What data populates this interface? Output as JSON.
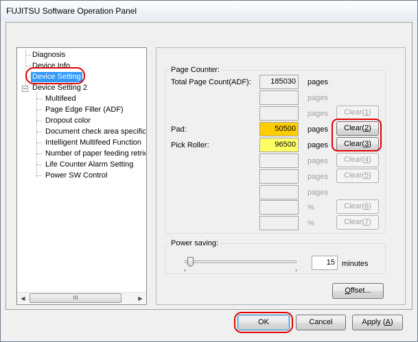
{
  "window": {
    "title": "FUJITSU Software Operation Panel"
  },
  "tree": {
    "items": [
      {
        "label": "Diagnosis"
      },
      {
        "label": "Device Info"
      },
      {
        "label": "Device Setting"
      },
      {
        "label": "Device Setting 2",
        "expander": "−"
      },
      {
        "label": "Multifeed"
      },
      {
        "label": "Page Edge Filler (ADF)"
      },
      {
        "label": "Dropout color"
      },
      {
        "label": "Document check area specific"
      },
      {
        "label": "Intelligent Multifeed Function"
      },
      {
        "label": "Number of paper feeding retrie"
      },
      {
        "label": "Life Counter Alarm Setting"
      },
      {
        "label": "Power SW Control"
      }
    ],
    "scroll_grip": "III",
    "scroll_left": "◀",
    "scroll_right": "▶"
  },
  "page_counter": {
    "group_title": "Page Counter:",
    "total_label": "Total Page Count(ADF):",
    "total_value": "185030",
    "pad_label": "Pad:",
    "pad_value": "50500",
    "pick_label": "Pick Roller:",
    "pick_value": "96500",
    "unit_pages": "pages",
    "unit_percent": "%",
    "clear1": {
      "pre": "Clear(",
      "key": "1",
      "post": ")"
    },
    "clear2": {
      "pre": "Clear(",
      "key": "2",
      "post": ")"
    },
    "clear3": {
      "pre": "Clear(",
      "key": "3",
      "post": ")"
    },
    "clear4": {
      "pre": "Clear(",
      "key": "4",
      "post": ")"
    },
    "clear5": {
      "pre": "Clear(",
      "key": "5",
      "post": ")"
    },
    "clear6": {
      "pre": "Clear(",
      "key": "6",
      "post": ")"
    },
    "clear7": {
      "pre": "Clear(",
      "key": "7",
      "post": ")"
    }
  },
  "power_saving": {
    "group_title": "Power saving:",
    "value": "15",
    "unit": "minutes"
  },
  "buttons": {
    "offset": {
      "key": "O",
      "rest": "ffset..."
    },
    "ok": "OK",
    "cancel": "Cancel",
    "apply": {
      "pre": "Apply (",
      "key": "A",
      "post": ")"
    }
  },
  "colors": {
    "pad_field": "#ffcc00",
    "pick_field": "#ffff66",
    "selection": "#3399ff",
    "annotation_ring": "#e00000"
  }
}
